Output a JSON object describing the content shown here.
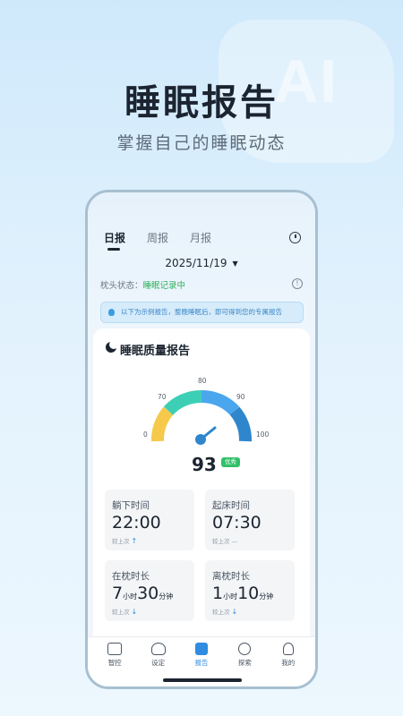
{
  "hero": {
    "title": "睡眠报告",
    "subtitle": "掌握自己的睡眠动态",
    "decor_text": "AI"
  },
  "tabs": [
    "日报",
    "周报",
    "月报"
  ],
  "active_tab": "日报",
  "date": "2025/11/19",
  "status": {
    "label": "枕头状态：",
    "value": "睡眠记录中"
  },
  "notice": "以下为示例报告，整晚睡眠后，即可得到您的专属报告",
  "card": {
    "title": "睡眠质量报告",
    "gauge": {
      "min": 0,
      "max": 100,
      "labels": [
        "0",
        "70",
        "80",
        "90",
        "100"
      ],
      "value": 93,
      "colors": [
        "#f6c94b",
        "#3ccfb6",
        "#4aa7ee",
        "#2f86cc"
      ]
    },
    "score": "93",
    "score_badge": "优秀",
    "stats": [
      {
        "label": "躺下时间",
        "value": "22:00",
        "compare": "较上次",
        "trend": "↑"
      },
      {
        "label": "起床时间",
        "value": "07:30",
        "compare": "较上次",
        "trend": "—"
      },
      {
        "label": "在枕时长",
        "value_h": "7",
        "unit_h": "小时",
        "value_m": "30",
        "unit_m": "分钟",
        "compare": "较上次",
        "trend": "↓"
      },
      {
        "label": "离枕时长",
        "value_h": "1",
        "unit_h": "小时",
        "value_m": "10",
        "unit_m": "分钟",
        "compare": "较上次",
        "trend": "↓"
      }
    ]
  },
  "nav": [
    {
      "label": "智控",
      "icon": "remote-icon"
    },
    {
      "label": "设定",
      "icon": "settings-icon"
    },
    {
      "label": "报告",
      "icon": "report-icon",
      "active": true
    },
    {
      "label": "探索",
      "icon": "explore-icon"
    },
    {
      "label": "我的",
      "icon": "profile-icon"
    }
  ]
}
